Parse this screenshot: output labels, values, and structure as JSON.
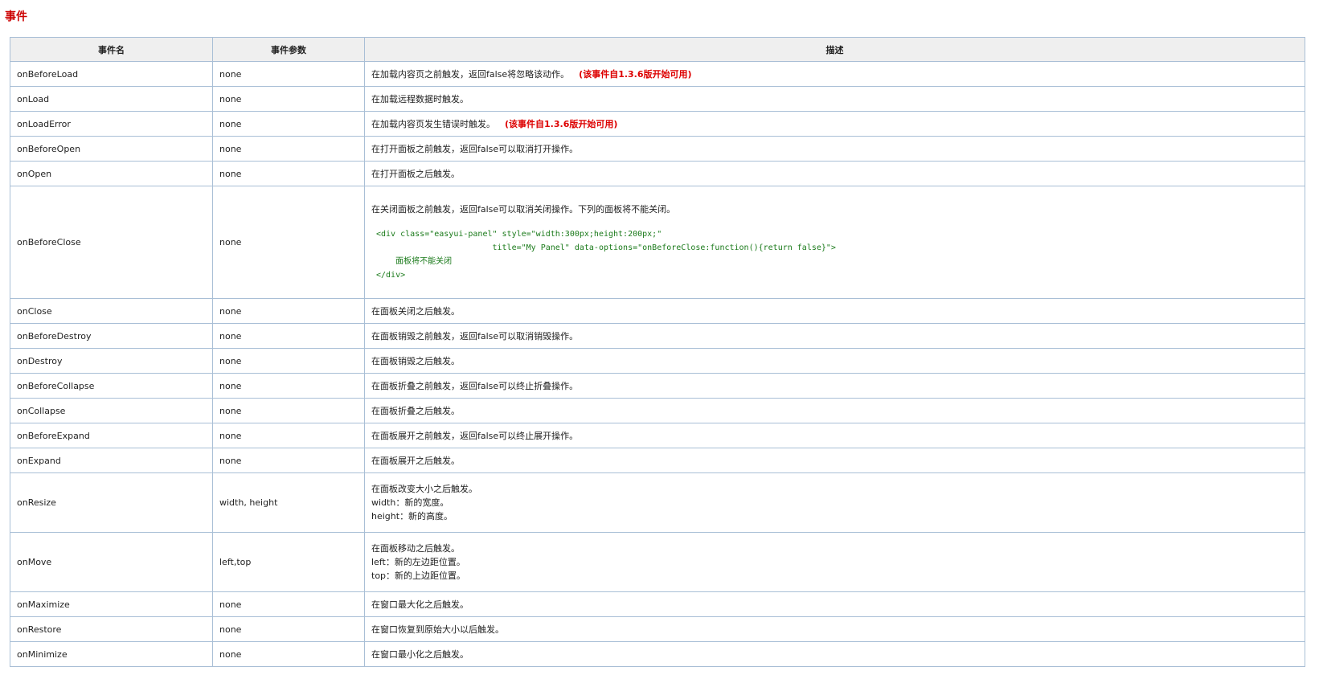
{
  "section": {
    "title": "事件"
  },
  "table": {
    "headers": {
      "name": "事件名",
      "param": "事件参数",
      "desc": "描述"
    },
    "rows": [
      {
        "name": "onBeforeLoad",
        "param": "none",
        "desc": "在加载内容页之前触发，返回false将忽略该动作。",
        "note": "(该事件自1.3.6版开始可用)"
      },
      {
        "name": "onLoad",
        "param": "none",
        "desc": "在加载远程数据时触发。"
      },
      {
        "name": "onLoadError",
        "param": "none",
        "desc": "在加载内容页发生错误时触发。",
        "note": "(该事件自1.3.6版开始可用)"
      },
      {
        "name": "onBeforeOpen",
        "param": "none",
        "desc": "在打开面板之前触发，返回false可以取消打开操作。"
      },
      {
        "name": "onOpen",
        "param": "none",
        "desc": "在打开面板之后触发。"
      },
      {
        "name": "onBeforeClose",
        "param": "none",
        "desc": "在关闭面板之前触发，返回false可以取消关闭操作。下列的面板将不能关闭。",
        "code": [
          "<div class=\"easyui-panel\" style=\"width:300px;height:200px;\"",
          "                        title=\"My Panel\" data-options=\"onBeforeClose:function(){return false}\">",
          "    面板将不能关闭",
          "</div>"
        ]
      },
      {
        "name": "onClose",
        "param": "none",
        "desc": "在面板关闭之后触发。"
      },
      {
        "name": "onBeforeDestroy",
        "param": "none",
        "desc": "在面板销毁之前触发，返回false可以取消销毁操作。"
      },
      {
        "name": "onDestroy",
        "param": "none",
        "desc": "在面板销毁之后触发。"
      },
      {
        "name": "onBeforeCollapse",
        "param": "none",
        "desc": "在面板折叠之前触发，返回false可以终止折叠操作。"
      },
      {
        "name": "onCollapse",
        "param": "none",
        "desc": "在面板折叠之后触发。"
      },
      {
        "name": "onBeforeExpand",
        "param": "none",
        "desc": "在面板展开之前触发，返回false可以终止展开操作。"
      },
      {
        "name": "onExpand",
        "param": "none",
        "desc": "在面板展开之后触发。"
      },
      {
        "name": "onResize",
        "param": "width, height",
        "desc": "在面板改变大小之后触发。",
        "lines": [
          "width：新的宽度。",
          "height：新的高度。"
        ]
      },
      {
        "name": "onMove",
        "param": "left,top",
        "desc": "在面板移动之后触发。",
        "lines": [
          "left：新的左边距位置。",
          "top：新的上边距位置。"
        ]
      },
      {
        "name": "onMaximize",
        "param": "none",
        "desc": "在窗口最大化之后触发。"
      },
      {
        "name": "onRestore",
        "param": "none",
        "desc": "在窗口恢复到原始大小以后触发。"
      },
      {
        "name": "onMinimize",
        "param": "none",
        "desc": "在窗口最小化之后触发。"
      }
    ]
  }
}
